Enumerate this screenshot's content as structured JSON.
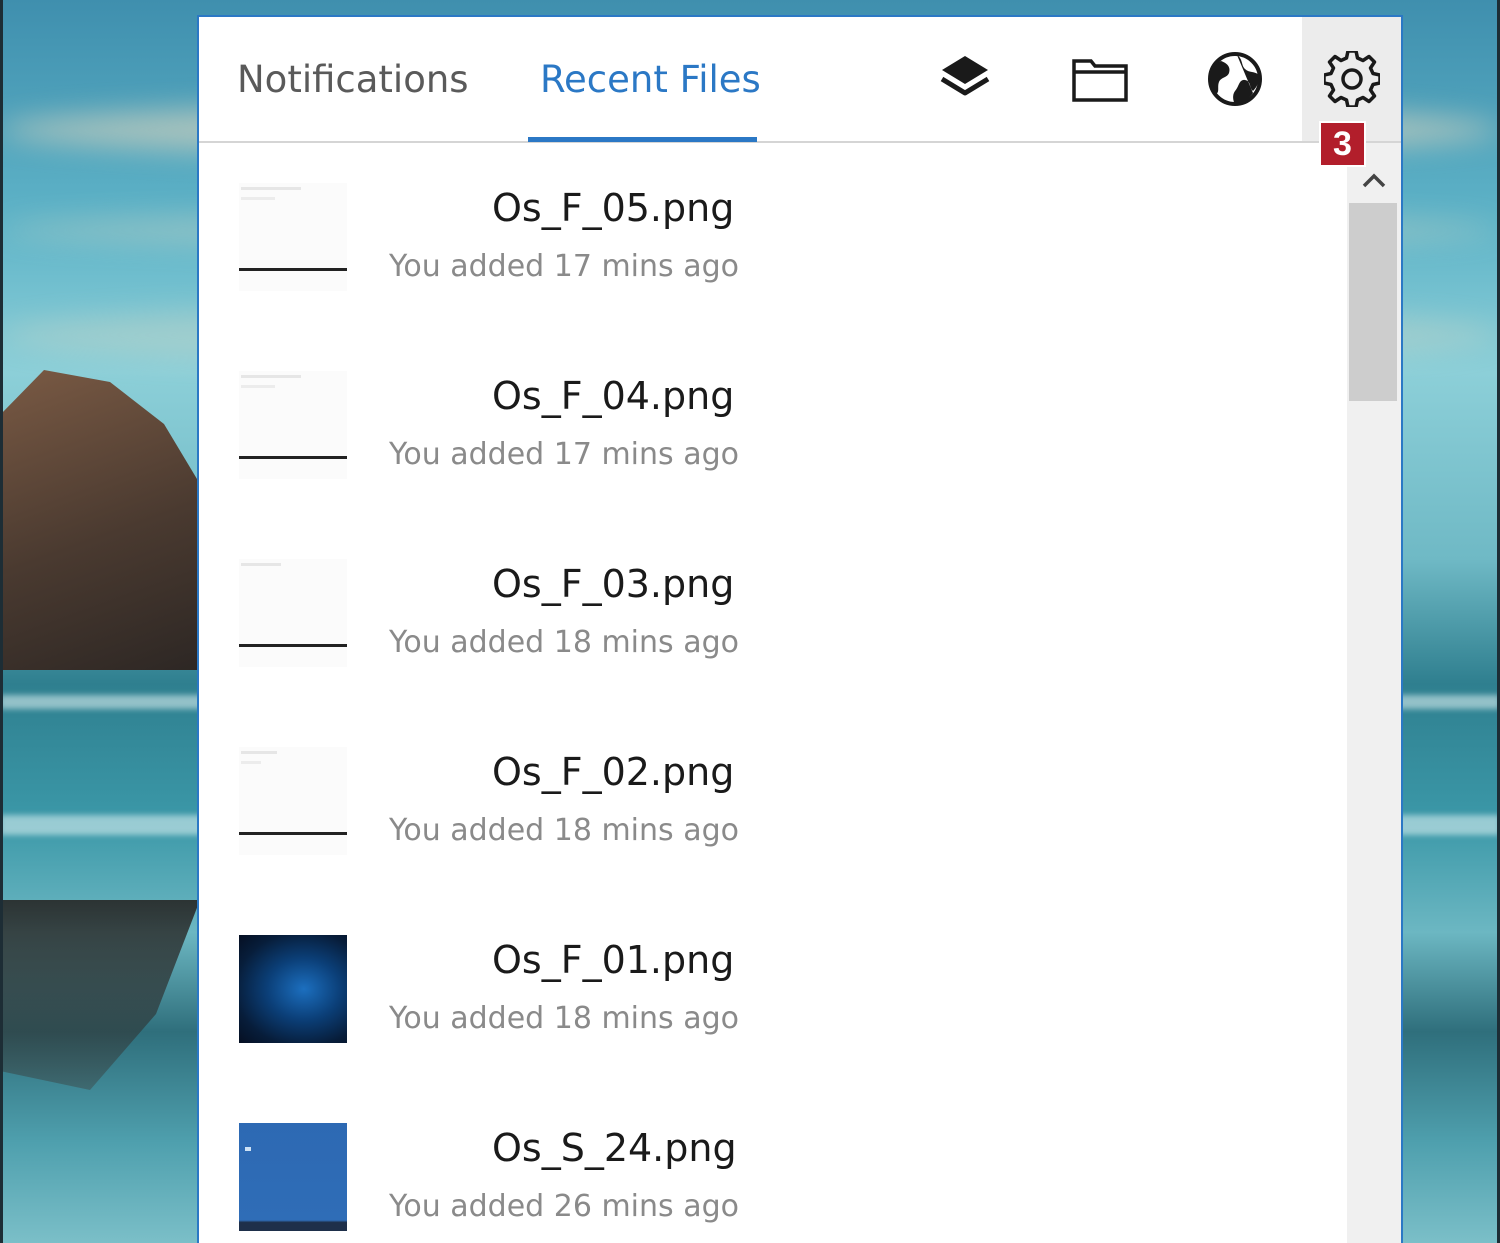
{
  "tabs": {
    "notifications": "Notifications",
    "recent_files": "Recent Files",
    "active": "recent_files"
  },
  "toolbar": {
    "icons": [
      "layers-icon",
      "folder-icon",
      "globe-icon",
      "gear-icon"
    ],
    "settings_badge": "3"
  },
  "files": [
    {
      "name": "Os_F_05.png",
      "meta": "You added 17 mins ago",
      "thumb": "blank-screenshot"
    },
    {
      "name": "Os_F_04.png",
      "meta": "You added 17 mins ago",
      "thumb": "blank-screenshot"
    },
    {
      "name": "Os_F_03.png",
      "meta": "You added 18 mins ago",
      "thumb": "blank-screenshot"
    },
    {
      "name": "Os_F_02.png",
      "meta": "You added 18 mins ago",
      "thumb": "blank-screenshot"
    },
    {
      "name": "Os_F_01.png",
      "meta": "You added 18 mins ago",
      "thumb": "windows-wallpaper"
    },
    {
      "name": "Os_S_24.png",
      "meta": "You added 26 mins ago",
      "thumb": "blue-screen"
    }
  ],
  "colors": {
    "accent": "#2b78c5",
    "badge": "#b21e2b",
    "meta_text": "#8a8a8a"
  }
}
